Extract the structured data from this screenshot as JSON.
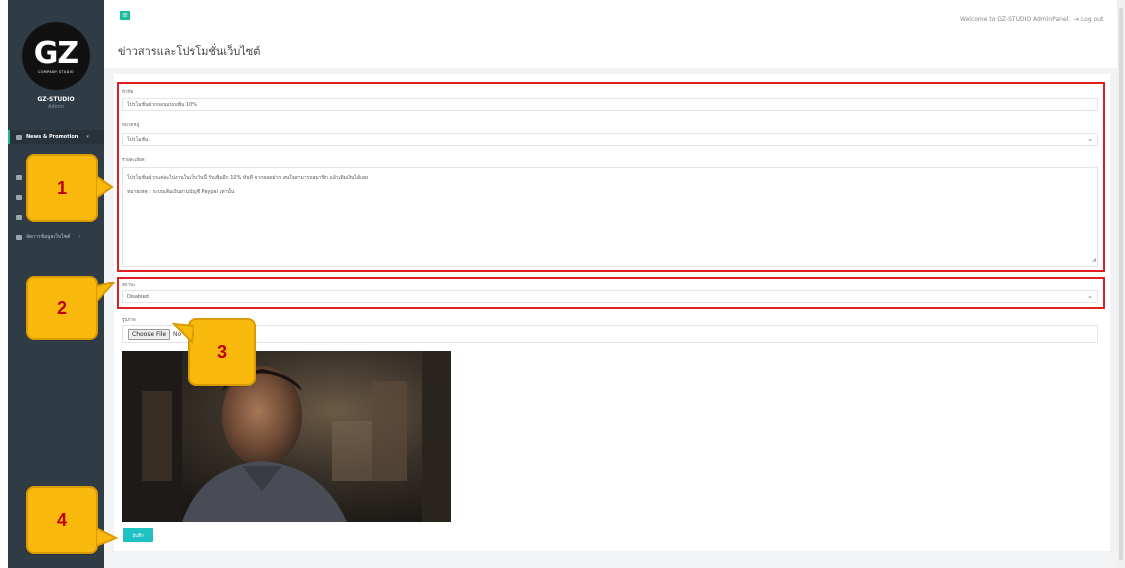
{
  "header": {
    "menu_icon": "hamburger-icon",
    "welcome_text": "Welcome to GZ-STUDIO AdminPanel.",
    "logout_label": "Log out",
    "logout_icon": "logout-icon"
  },
  "sidebar": {
    "logo_text": "GZ",
    "logo_subtext": "COMPANY STUDIO",
    "user_name": "GZ-STUDIO",
    "user_role": "Admin",
    "items": [
      {
        "label": "News & Promotion",
        "icon": "newspaper-icon",
        "active": true,
        "caret": "▾"
      },
      {
        "label": "",
        "icon": "list-icon"
      },
      {
        "label": "",
        "icon": "users-icon"
      },
      {
        "label": "",
        "icon": "users-icon"
      },
      {
        "label": "จัดการข้อมูลเว็บไซต์",
        "icon": "gears-icon",
        "caret": "‹"
      }
    ]
  },
  "page": {
    "title": "ข่าวสารและโปรโมชั่นเว็บไซต์"
  },
  "form": {
    "title_label": "หัวข้อ",
    "title_value": "โปรโมชั่นฝากถอนแบกเพิ่ม 10%",
    "category_label": "หมวดหมู่",
    "category_value": "โปรโมชั่น",
    "detail_label": "รายละเอียด",
    "detail_line1": "โปรโมชั่นฝากแต่ละไปงานในเว็บวันนี้ รับเพิ่มอีก 10% ทันที จากยอดฝาก สนใจสามารถสมาชิก แล้วเติมเงินได้เลย",
    "detail_line2": "หมายเหตุ : ระบบเติมเงินผ่านบัญชี Paypal เท่านั้น",
    "status_label": "สถานะ",
    "status_value": "Disabled",
    "image_label": "รูปภาพ",
    "choose_file_label": "Choose File",
    "file_text": "No",
    "save_label": "บันทึก"
  },
  "callouts": [
    "1",
    "2",
    "3",
    "4"
  ],
  "colors": {
    "sidebar_bg": "#2f3b45",
    "accent": "#1abc9c",
    "save_button": "#1fc1c3",
    "highlight_border": "#e02020",
    "callout_fill": "#f9b90c",
    "callout_text": "#c00000"
  }
}
